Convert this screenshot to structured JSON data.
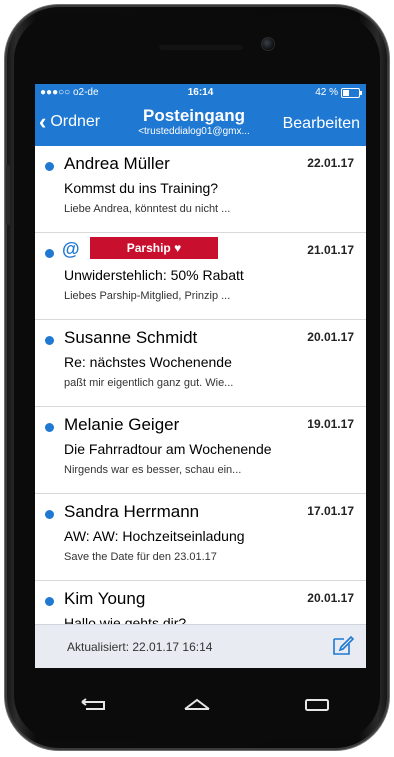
{
  "status": {
    "carrier": "●●●○○ o2-de",
    "time": "16:14",
    "battery": "42 %",
    "battery_level": 0.42
  },
  "nav": {
    "back_label": "Ordner",
    "title": "Posteingang",
    "subtitle": "<trusteddialog01@gmx...",
    "edit_label": "Bearbeiten"
  },
  "messages": [
    {
      "sender": "Andrea Müller",
      "date": "22.01.17",
      "subject": "Kommst du ins Training?",
      "preview": "Liebe Andrea, könntest du nicht ..."
    },
    {
      "badge": "Parship ♥",
      "date": "21.01.17",
      "subject": "Unwiderstehlich: 50% Rabatt",
      "preview": "Liebes Parship-Mitglied, Prinzip ..."
    },
    {
      "sender": "Susanne Schmidt",
      "date": "20.01.17",
      "subject": "Re: nächstes Wochenende",
      "preview": "paßt mir eigentlich ganz gut. Wie..."
    },
    {
      "sender": "Melanie Geiger",
      "date": "19.01.17",
      "subject": "Die Fahrradtour am Wochenende",
      "preview": "Nirgends war es besser, schau ein..."
    },
    {
      "sender": "Sandra Herrmann",
      "date": "17.01.17",
      "subject": "AW: AW: Hochzeitseinladung",
      "preview": "Save the Date für den 23.01.17"
    },
    {
      "sender": "Kim Young",
      "date": "20.01.17",
      "subject": "Hallo wie gehts dir?",
      "preview": ""
    }
  ],
  "footer": {
    "updated": "Aktualisiert:  22.01.17 16:14"
  },
  "colors": {
    "accent": "#1f78d1",
    "ad_badge": "#c8102e"
  },
  "icons": {
    "back": "chevron-left-icon",
    "compose": "compose-icon",
    "ad": "at-sign-icon"
  }
}
